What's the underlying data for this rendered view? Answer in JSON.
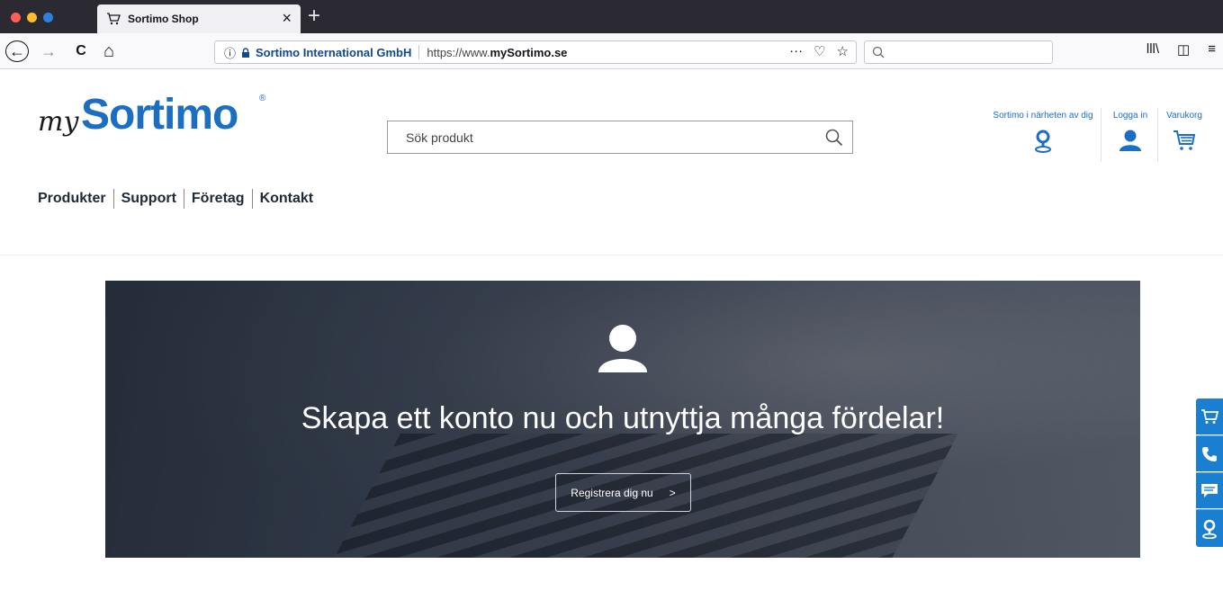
{
  "browser": {
    "tab_title": "Sortimo Shop",
    "tab_close": "×",
    "new_tab": "+",
    "back": "←",
    "forward": "→",
    "reload": "C",
    "home": "⌂",
    "url_info": "ⓘ",
    "url_org": "Sortimo International GmbH",
    "url_prefix": "https://www.",
    "url_domain": "mySortimo.se",
    "page_actions": "···",
    "pocket": "♡",
    "bookmark": "☆",
    "library": "lll\\",
    "sidebar": "◫",
    "menu": "≡"
  },
  "site": {
    "logo_my": "my",
    "logo_main": "Sortimo",
    "logo_reg": "®",
    "search_placeholder": "Sök produkt",
    "header_links": {
      "nearby": "Sortimo i närheten av dig",
      "login": "Logga in",
      "cart": "Varukorg"
    },
    "nav": [
      "Produkter",
      "Support",
      "Företag",
      "Kontakt"
    ],
    "hero": {
      "title": "Skapa ett konto nu och utnyttja många fördelar!",
      "button_label": "Registrera dig nu",
      "button_arrow": ">"
    }
  },
  "colors": {
    "brand_blue": "#1b6ec2",
    "side_blue": "#1b7fd1"
  },
  "icons": {
    "side_buttons": [
      "cart-icon",
      "phone-icon",
      "chat-icon",
      "location-icon"
    ]
  }
}
